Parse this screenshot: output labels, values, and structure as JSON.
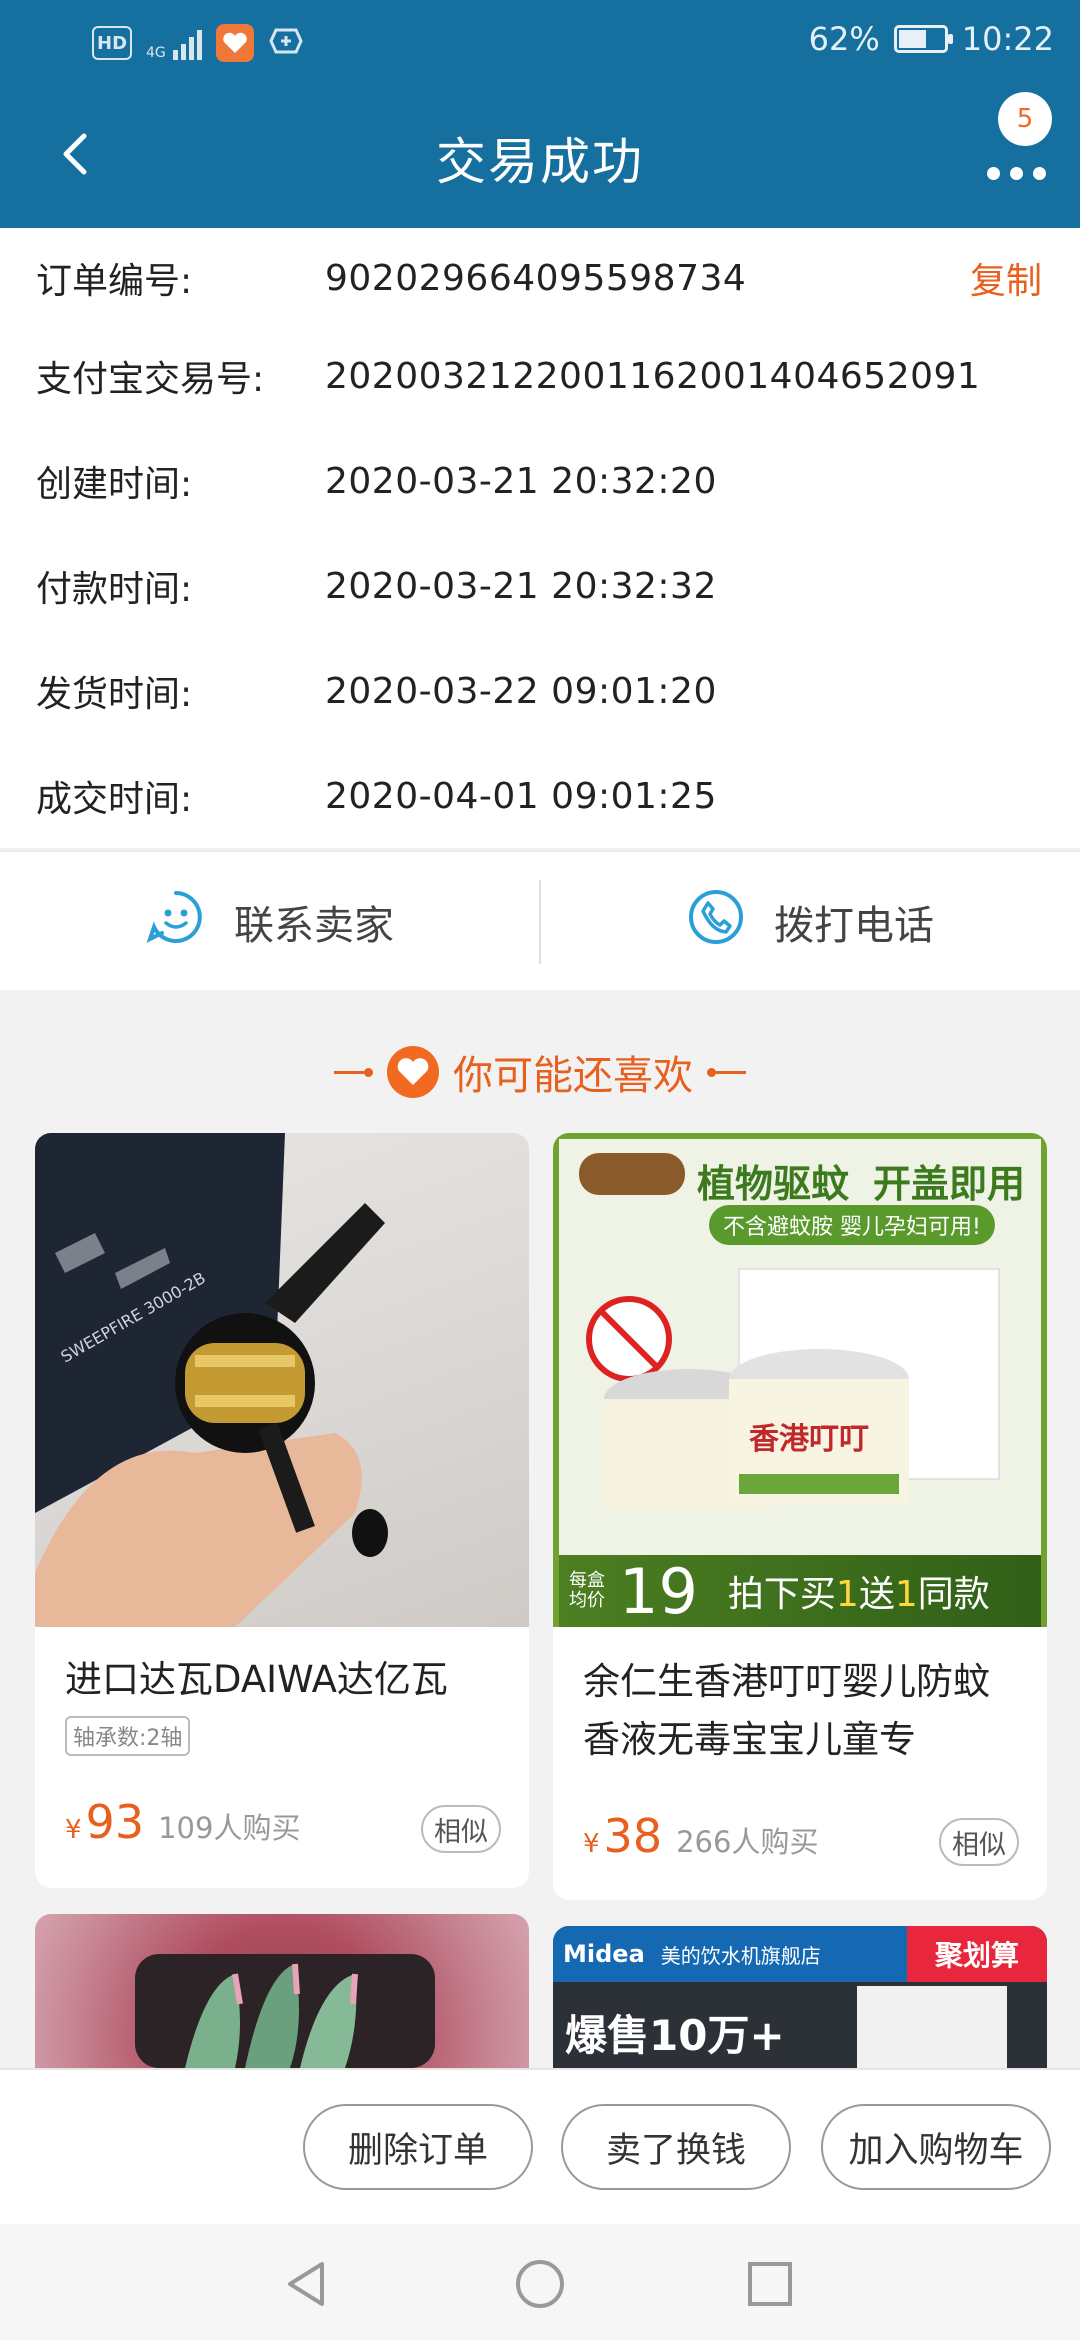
{
  "status_bar": {
    "hd_label": "HD",
    "network_label": "4G",
    "battery_text": "62%",
    "battery_level": 0.62,
    "time": "10:22"
  },
  "header": {
    "title": "交易成功",
    "badge_count": "5",
    "back_icon": "chevron-left-icon",
    "more_icon": "more-dots-icon",
    "bg_color": "#16709f"
  },
  "order": {
    "rows": [
      {
        "label": "订单编号:",
        "value": "902029664095598734"
      },
      {
        "label": "支付宝交易号:",
        "value": "2020032122001162001404652091"
      },
      {
        "label": "创建时间:",
        "value": "2020-03-21 20:32:20"
      },
      {
        "label": "付款时间:",
        "value": "2020-03-21 20:32:32"
      },
      {
        "label": "发货时间:",
        "value": "2020-03-22 09:01:20"
      },
      {
        "label": "成交时间:",
        "value": "2020-04-01 09:01:25"
      }
    ],
    "copy_label": "复制",
    "accent_color": "#e8601d"
  },
  "contact": {
    "seller_label": "联系卖家",
    "seller_icon": "chat-face-icon",
    "phone_label": "拨打电话",
    "phone_icon": "phone-icon"
  },
  "recommend": {
    "title": "你可能还喜欢",
    "items": [
      {
        "title": "进口达瓦DAIWA达亿瓦",
        "tag": "轴承数:2轴",
        "currency": "¥",
        "price": "93",
        "sold": "109人购买",
        "similar": "相似",
        "img_brand": "SWEEPFIRE 3000-2B"
      },
      {
        "title": "余仁生香港叮叮婴儿防蚊香液无毒宝宝儿童专",
        "currency": "¥",
        "price": "38",
        "sold": "266人购买",
        "similar": "相似",
        "img_headline_1": "植物驱蚊",
        "img_headline_2": "开盖即用",
        "img_sub": "不含避蚊胺 婴儿孕妇可用!",
        "img_product": "香港叮叮",
        "img_price_label": "每盒均价",
        "img_price": "19",
        "img_promo_1": "拍下买",
        "img_promo_2": "1",
        "img_promo_3": "送",
        "img_promo_4": "1",
        "img_promo_5": "同款"
      },
      {
        "title": ""
      },
      {
        "img_brand": "Midea",
        "img_store": "美的饮水机旗舰店",
        "img_promo": "聚划算",
        "img_headline": "爆售10万+"
      }
    ]
  },
  "actions": {
    "delete": "删除订单",
    "resell": "卖了换钱",
    "add_cart": "加入购物车"
  },
  "nav": {
    "back_icon": "nav-back-triangle-icon",
    "home_icon": "nav-home-circle-icon",
    "recents_icon": "nav-recents-square-icon"
  }
}
